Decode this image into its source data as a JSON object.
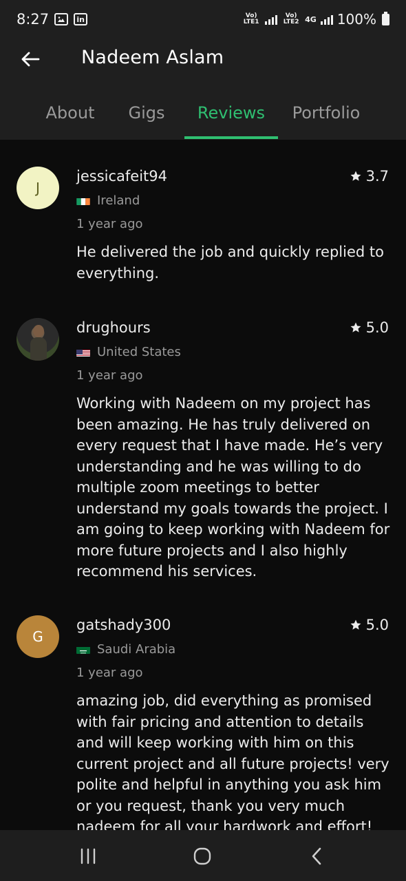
{
  "status_bar": {
    "time": "8:27",
    "left_icons": [
      "image-icon",
      "linkedin-icon"
    ],
    "network_1": "Vo) LTE1",
    "network_2": "Vo) LTE2",
    "data_type": "4G",
    "battery": "100%"
  },
  "app_bar": {
    "title": "Nadeem Aslam",
    "back_icon": "back-arrow-icon"
  },
  "tabs": [
    {
      "label": "About",
      "active": false
    },
    {
      "label": "Gigs",
      "active": false
    },
    {
      "label": "Reviews",
      "active": true
    },
    {
      "label": "Portfolio",
      "active": false
    }
  ],
  "reviews": [
    {
      "avatar_letter": "J",
      "avatar_color": "#f2f3c4",
      "avatar_text_color": "#5b5d1f",
      "username": "jessicafeit94",
      "rating": "3.7",
      "country": "Ireland",
      "time": "1 year ago",
      "text": "He delivered the job and quickly replied to everything."
    },
    {
      "avatar_letter": "",
      "avatar_color": "#2b2b2b",
      "username": "drughours",
      "rating": "5.0",
      "country": "United States",
      "time": "1 year ago",
      "text": "Working with Nadeem on my project has been amazing. He has truly delivered on every request that I have made. He’s very understanding and he was willing to do multiple zoom meetings to better understand my goals towards the project. I am going to keep working with Nadeem for more future projects and I also highly recommend his services."
    },
    {
      "avatar_letter": "G",
      "avatar_color": "#b9853a",
      "avatar_text_color": "#ffffff",
      "username": "gatshady300",
      "rating": "5.0",
      "country": "Saudi Arabia",
      "time": "1 year ago",
      "text": "amazing job, did everything as promised with fair pricing and attention to details and will keep working with him on this current project and all future projects! very polite and helpful in anything you ask him or you request, thank you very much nadeem for all your hardwork and effort!"
    }
  ],
  "colors": {
    "accent": "#2fbf71",
    "background": "#0c0c0c",
    "header_bg": "#1f1f1f"
  },
  "nav_bar": {
    "recents_icon": "recents-icon",
    "home_icon": "home-icon",
    "back_icon": "nav-back-icon"
  }
}
